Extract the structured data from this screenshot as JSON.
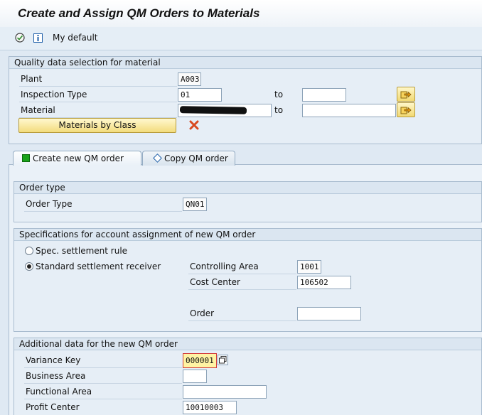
{
  "window": {
    "title": "Create and Assign QM Orders to Materials"
  },
  "toolbar": {
    "variant_label": "My default",
    "execute_icon": "execute-icon",
    "info_icon": "information-icon"
  },
  "selection": {
    "heading": "Quality data selection for material",
    "plant_label": "Plant",
    "plant_value": "A003",
    "inspection_type_label": "Inspection Type",
    "inspection_type_from": "01",
    "inspection_type_to": "",
    "material_label": "Material",
    "material_from": "",
    "material_to": "",
    "to_label": "to",
    "materials_by_class_button": "Materials by Class"
  },
  "tabs": [
    {
      "label": "Create new QM order",
      "active": true
    },
    {
      "label": "Copy QM order",
      "active": false
    }
  ],
  "order_type": {
    "heading": "Order type",
    "label": "Order Type",
    "value": "QN01"
  },
  "account": {
    "heading": "Specifications for account assignment of new QM order",
    "radio1_label": "Spec. settlement rule",
    "radio1_selected": false,
    "radio2_label": "Standard settlement receiver",
    "radio2_selected": true,
    "controlling_area_label": "Controlling Area",
    "controlling_area_value": "1001",
    "cost_center_label": "Cost Center",
    "cost_center_value": "106502",
    "order_label": "Order",
    "order_value": ""
  },
  "additional": {
    "heading": "Additional data for the new QM order",
    "variance_key_label": "Variance Key",
    "variance_key_value": "000001",
    "business_area_label": "Business Area",
    "business_area_value": "",
    "functional_area_label": "Functional Area",
    "functional_area_value": "",
    "profit_center_label": "Profit Center",
    "profit_center_value": "10010003"
  },
  "colors": {
    "accent_yellow": "#f3dc7d",
    "tab_active_marker": "#19a319",
    "focus_border": "#d23b3b",
    "focus_fill": "#fff3a3"
  }
}
